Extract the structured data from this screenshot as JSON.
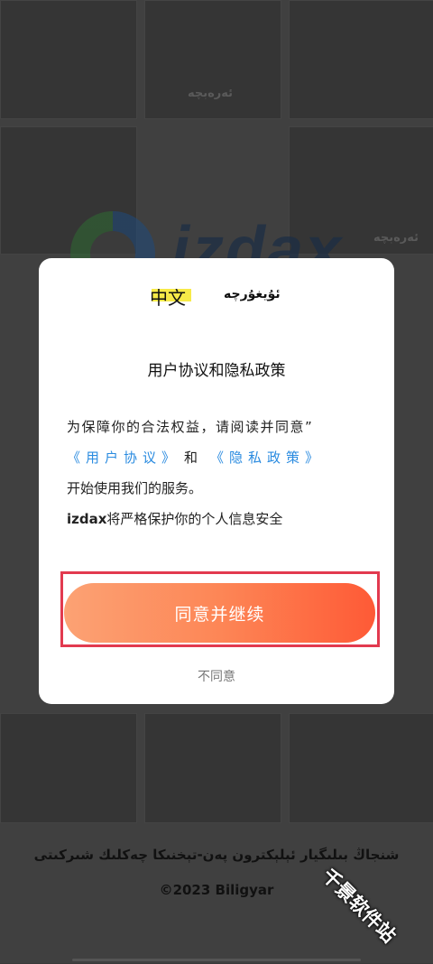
{
  "background": {
    "uyghur_label_1": "ئەرەبچە",
    "uyghur_label_2": "ئەرەبچە",
    "logo_text": "izdax"
  },
  "modal": {
    "lang_chinese": "中文",
    "lang_uyghur": "ئۇيغۇرچە",
    "title": "用户协议和隐私政策",
    "line1": "为保障你的合法权益，请阅读并同意”",
    "user_agreement": "《用户协议》",
    "and": "和",
    "privacy_policy": "《隐私政策》",
    "line3": "开始使用我们的服务。",
    "brand": "izdax",
    "line4_rest": "将严格保护你的个人信息安全",
    "agree_button": "同意并继续",
    "decline_button": "不同意"
  },
  "footer": {
    "company": "شنجاڭ بىلىگيار ئېلېكترون پەن-تېخنىكا چەكلىك شىركىتى",
    "copyright": "©2023 Biligyar"
  },
  "watermark": "千景软件站",
  "colors": {
    "accent_start": "#fca274",
    "accent_end": "#fe5a36",
    "link": "#2a8be0",
    "highlight_box": "#e23a4f",
    "lang_highlight": "#f7ea48"
  }
}
